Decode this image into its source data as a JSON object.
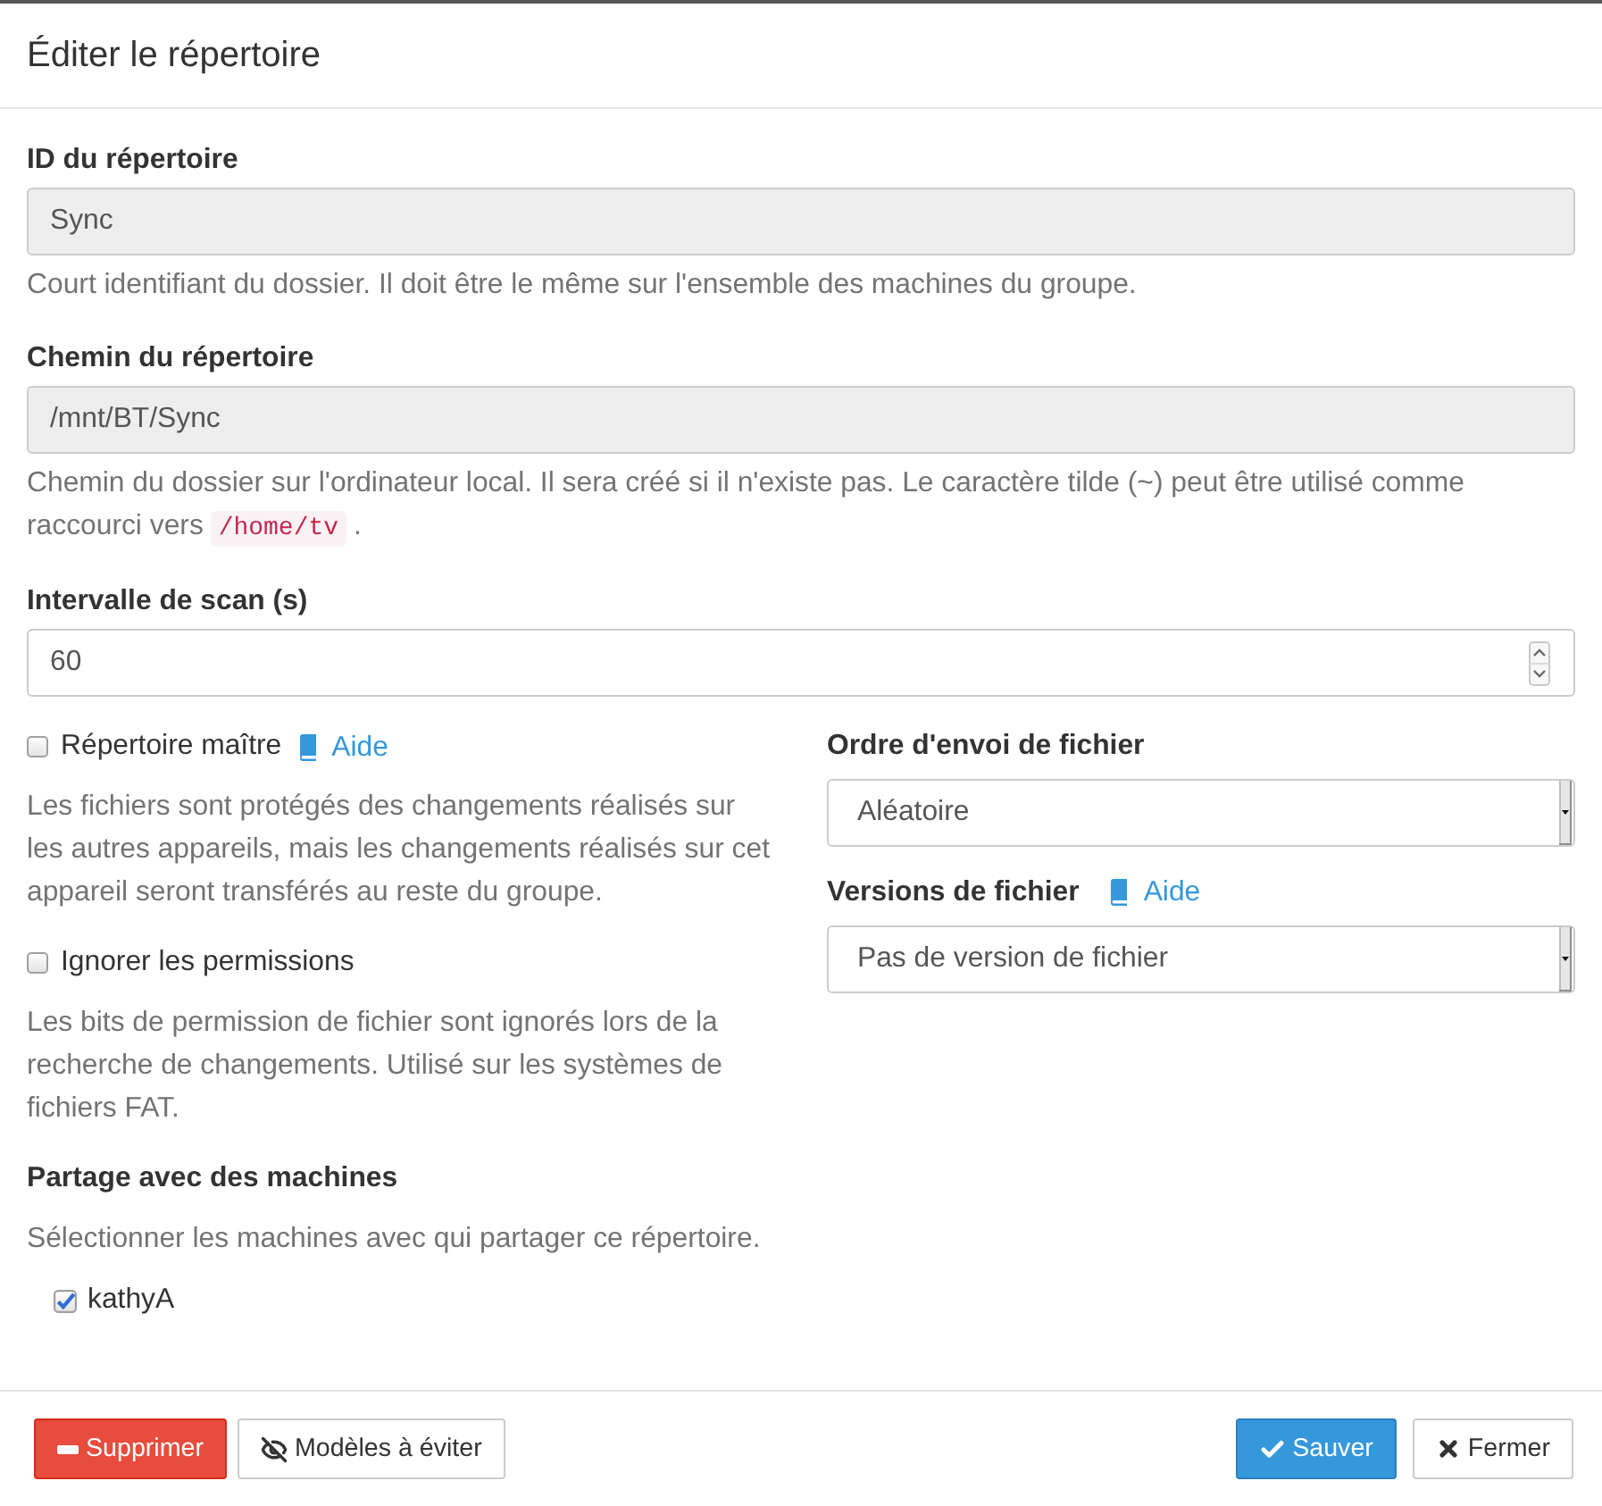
{
  "dialog": {
    "title": "Éditer le répertoire"
  },
  "fields": [
    {
      "kind": "text",
      "label": "ID du répertoire",
      "value": "Sync",
      "disabled": true,
      "help": [
        {
          "kind": "text",
          "text": "Court identifiant du dossier. Il doit être le même sur l'ensemble des machines du groupe."
        }
      ]
    },
    {
      "kind": "text",
      "label": "Chemin du répertoire",
      "value": "/mnt/BT/Sync",
      "disabled": true,
      "help": [
        {
          "kind": "text",
          "text": "Chemin du dossier sur l'ordinateur local. Il sera créé si il n'existe pas. Le caractère tilde (~) peut être utilisé comme raccourci vers"
        },
        {
          "kind": "code",
          "text": "/home/tv"
        },
        {
          "kind": "text",
          "text": "."
        }
      ]
    },
    {
      "kind": "number",
      "label": "Intervalle de scan (s)",
      "value": "60",
      "disabled": false
    }
  ],
  "options": [
    {
      "label": "Répertoire maître",
      "checked": false,
      "help_link": "Aide",
      "description": "Les fichiers sont protégés des changements réalisés sur les autres appareils, mais les changements réalisés sur cet appareil seront transférés au reste du groupe."
    },
    {
      "label": "Ignorer les permissions",
      "checked": false,
      "description": "Les bits de permission de fichier sont ignorés lors de la recherche de changements. Utilisé sur les systèmes de fichiers FAT."
    }
  ],
  "sharing": {
    "label": "Partage avec des machines",
    "help": "Sélectionner les machines avec qui partager ce répertoire.",
    "devices": [
      {
        "name": "kathyA",
        "checked": true
      }
    ]
  },
  "selects": [
    {
      "label": "Ordre d'envoi de fichier",
      "value": "Aléatoire"
    },
    {
      "label": "Versions de fichier",
      "help_link": "Aide",
      "value": "Pas de version de fichier"
    }
  ],
  "footer": {
    "left_buttons": [
      {
        "kind": "delete",
        "label": "Supprimer"
      },
      {
        "kind": "ignore",
        "label": "Modèles à éviter"
      }
    ],
    "right_buttons": [
      {
        "kind": "save",
        "label": "Sauver"
      },
      {
        "kind": "close",
        "label": "Fermer"
      }
    ]
  }
}
